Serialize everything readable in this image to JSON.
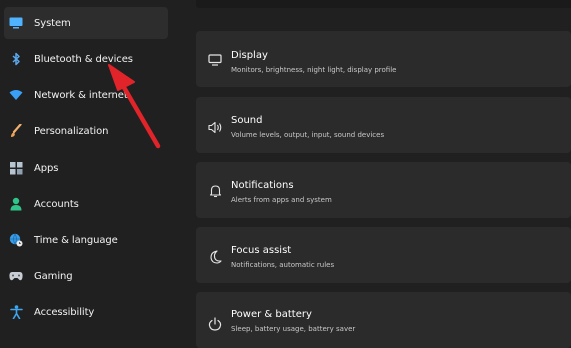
{
  "sidebar": {
    "items": [
      {
        "label": "System",
        "icon": "monitor-icon",
        "active": true
      },
      {
        "label": "Bluetooth & devices",
        "icon": "bluetooth-icon"
      },
      {
        "label": "Network & internet",
        "icon": "wifi-icon"
      },
      {
        "label": "Personalization",
        "icon": "brush-icon"
      },
      {
        "label": "Apps",
        "icon": "apps-icon"
      },
      {
        "label": "Accounts",
        "icon": "person-icon"
      },
      {
        "label": "Time & language",
        "icon": "globe-clock-icon"
      },
      {
        "label": "Gaming",
        "icon": "gamepad-icon"
      },
      {
        "label": "Accessibility",
        "icon": "accessibility-icon"
      }
    ]
  },
  "main": {
    "cards": [
      {
        "title": "Display",
        "subtitle": "Monitors, brightness, night light, display profile",
        "icon": "display-icon"
      },
      {
        "title": "Sound",
        "subtitle": "Volume levels, output, input, sound devices",
        "icon": "speaker-icon"
      },
      {
        "title": "Notifications",
        "subtitle": "Alerts from apps and system",
        "icon": "bell-icon"
      },
      {
        "title": "Focus assist",
        "subtitle": "Notifications, automatic rules",
        "icon": "moon-icon"
      },
      {
        "title": "Power & battery",
        "subtitle": "Sleep, battery usage, battery saver",
        "icon": "power-icon"
      }
    ]
  },
  "colors": {
    "background": "#202020",
    "card": "#2b2b2b",
    "annotation_arrow": "#e0242a"
  }
}
